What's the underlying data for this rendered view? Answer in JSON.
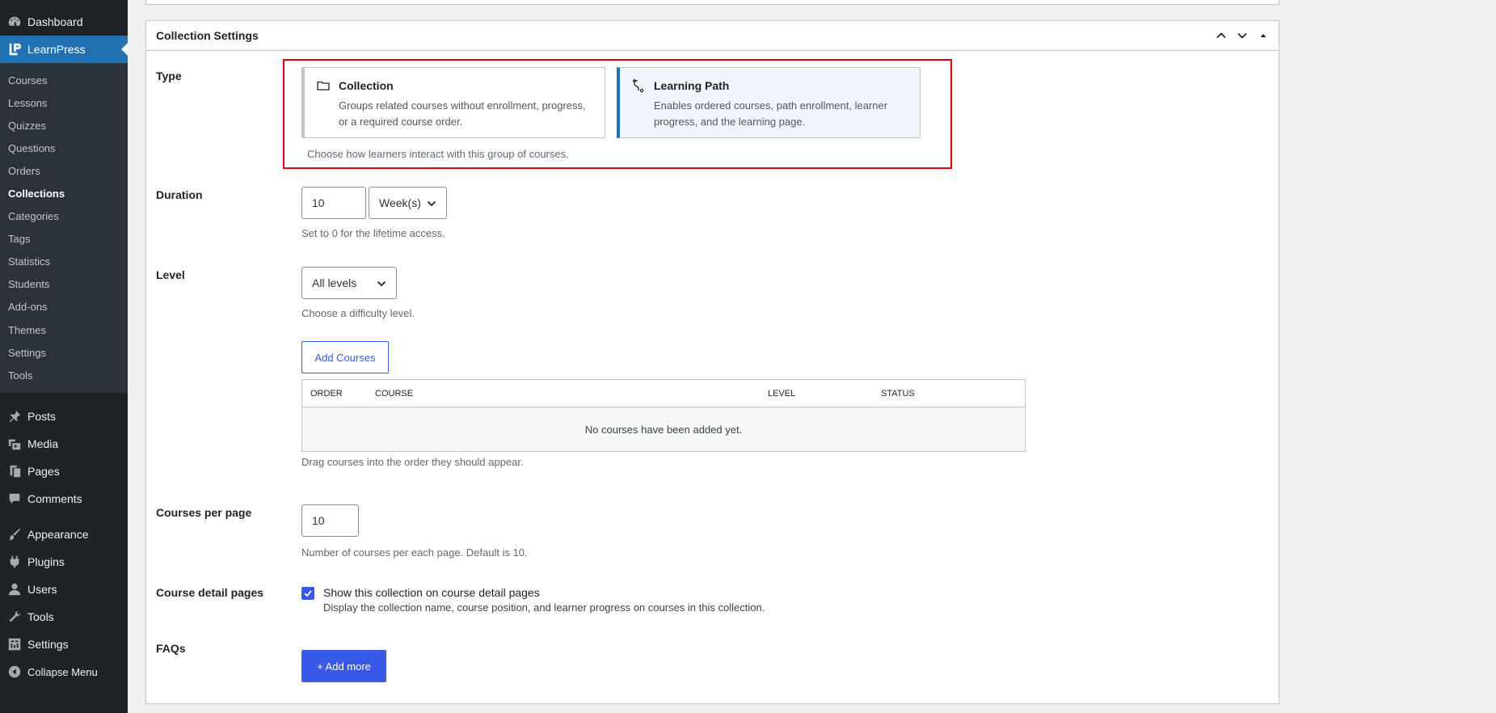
{
  "sidebar": {
    "top_items": [
      {
        "label": "Dashboard",
        "icon": "dashboard-icon"
      },
      {
        "label": "LearnPress",
        "icon": "learnpress-icon"
      }
    ],
    "submenu": [
      {
        "label": "Courses"
      },
      {
        "label": "Lessons"
      },
      {
        "label": "Quizzes"
      },
      {
        "label": "Questions"
      },
      {
        "label": "Orders"
      },
      {
        "label": "Collections"
      },
      {
        "label": "Categories"
      },
      {
        "label": "Tags"
      },
      {
        "label": "Statistics"
      },
      {
        "label": "Students"
      },
      {
        "label": "Add-ons"
      },
      {
        "label": "Themes"
      },
      {
        "label": "Settings"
      },
      {
        "label": "Tools"
      }
    ],
    "group1": [
      {
        "label": "Posts",
        "icon": "pin-icon"
      },
      {
        "label": "Media",
        "icon": "media-icon"
      },
      {
        "label": "Pages",
        "icon": "pages-icon"
      },
      {
        "label": "Comments",
        "icon": "comment-icon"
      }
    ],
    "group2": [
      {
        "label": "Appearance",
        "icon": "paintbrush-icon"
      },
      {
        "label": "Plugins",
        "icon": "plugin-icon"
      },
      {
        "label": "Users",
        "icon": "user-icon"
      },
      {
        "label": "Tools",
        "icon": "wrench-icon"
      },
      {
        "label": "Settings",
        "icon": "settings-icon"
      },
      {
        "label": "Collapse Menu",
        "icon": "collapse-icon"
      }
    ],
    "current_color": "#2271b1"
  },
  "panel": {
    "title": "Collection Settings",
    "type": {
      "label": "Type",
      "options": [
        {
          "title": "Collection",
          "description": "Groups related courses without enrollment, progress, or a required course order.",
          "icon": "folder-icon"
        },
        {
          "title": "Learning Path",
          "description": "Enables ordered courses, path enrollment, learner progress, and the learning page.",
          "icon": "route-icon"
        }
      ],
      "selected": "Learning Path",
      "help": "Choose how learners interact with this group of courses."
    },
    "duration": {
      "label": "Duration",
      "value": "10",
      "unit": "Week(s)",
      "help": "Set to 0 for the lifetime access."
    },
    "level": {
      "label": "Level",
      "value": "All levels",
      "help": "Choose a difficulty level."
    },
    "add_courses_label": "Add Courses",
    "courses_table": {
      "columns": [
        "ORDER",
        "COURSE",
        "LEVEL",
        "STATUS"
      ],
      "empty_message": "No courses have been added yet.",
      "help": "Drag courses into the order they should appear."
    },
    "courses_per_page": {
      "label": "Courses per page",
      "value": "10",
      "help": "Number of courses per each page. Default is 10."
    },
    "course_detail": {
      "label": "Course detail pages",
      "checkbox_label": "Show this collection on course detail pages",
      "checked": true,
      "help": "Display the collection name, course position, and learner progress on courses in this collection."
    },
    "faqs": {
      "label": "FAQs",
      "add_label": "+ Add more"
    }
  },
  "colors": {
    "accent": "#3858e9",
    "highlight": "#e3000f"
  }
}
